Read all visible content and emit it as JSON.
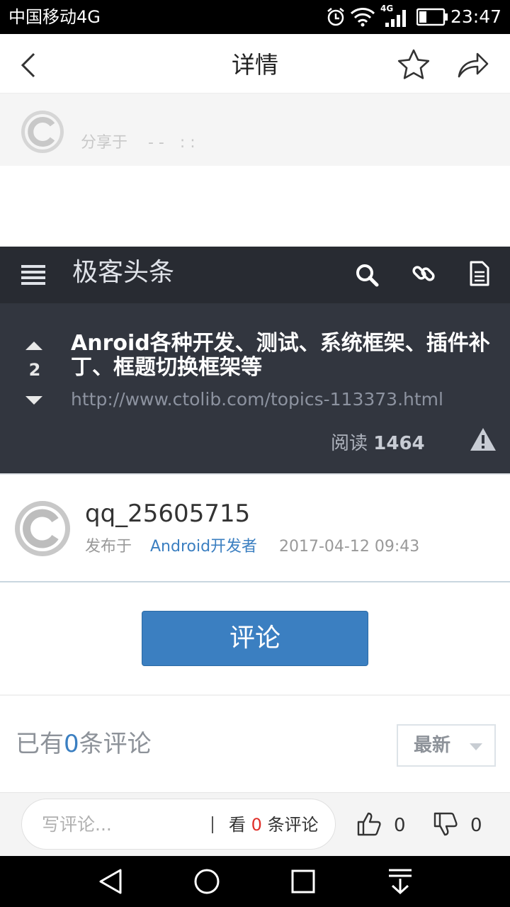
{
  "status_bar": {
    "carrier": "中国移动4G",
    "network": "4G",
    "time": "23:47"
  },
  "header": {
    "title": "详情"
  },
  "share": {
    "text": "分享于　 - -　: :"
  },
  "card": {
    "brand": "极客头条",
    "vote_count": "2",
    "headline": "Anroid各种开发、测试、系统框架、插件补丁、框题切换框架等",
    "url": "http://www.ctolib.com/topics-113373.html",
    "read_label": "阅读",
    "read_count": "1464"
  },
  "author": {
    "username": "qq_25605715",
    "published_label": "发布于",
    "category": "Android开发者",
    "datetime": "2017-04-12 09:43"
  },
  "comment_button": {
    "label": "评论"
  },
  "comments": {
    "prefix": "已有",
    "count": "0",
    "suffix": "条评论",
    "sort_label": "最新"
  },
  "bottom_bar": {
    "placeholder": "写评论...",
    "see_label": "看",
    "see_count": "0",
    "see_suffix": "条评论",
    "likes": "0",
    "dislikes": "0"
  },
  "colors": {
    "accent": "#3b7fc1",
    "card_bg": "#32363f",
    "card_bar": "#282b32",
    "red": "#e0302a"
  }
}
